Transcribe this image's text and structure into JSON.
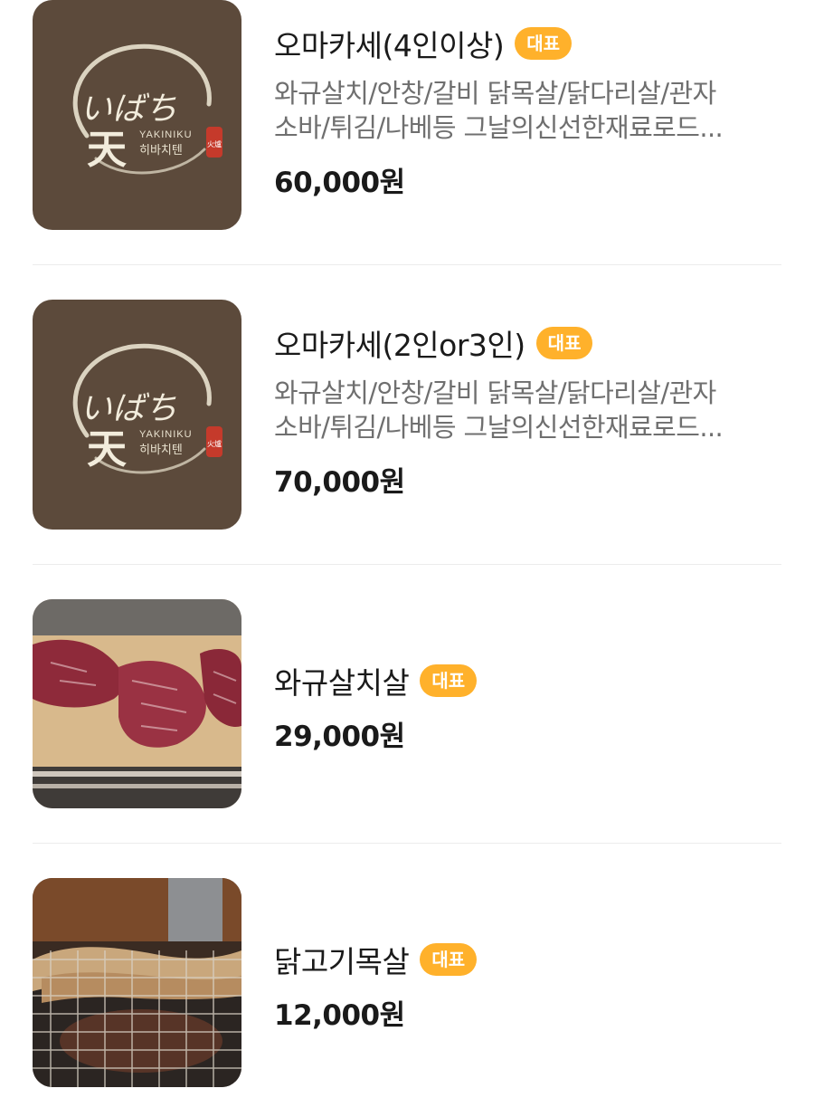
{
  "menu": {
    "items": [
      {
        "name": "오마카세(4인이상)",
        "badge": "대표",
        "desc_line1": "와규살치/안창/갈비 닭목살/닭다리살/관자",
        "desc_line2": "소바/튀김/나베등 그날의신선한재료로드...",
        "price": "60,000원",
        "logo": {
          "script": "いばち",
          "kanji": "天",
          "latin": "YAKINIKU",
          "korean": "히바치텐",
          "stamp": "火爐"
        }
      },
      {
        "name": "오마카세(2인or3인)",
        "badge": "대표",
        "desc_line1": "와규살치/안창/갈비 닭목살/닭다리살/관자",
        "desc_line2": "소바/튀김/나베등 그날의신선한재료로드...",
        "price": "70,000원",
        "logo": {
          "script": "いばち",
          "kanji": "天",
          "latin": "YAKINIKU",
          "korean": "히바치텐",
          "stamp": "火爐"
        }
      },
      {
        "name": "와규살치살",
        "badge": "대표",
        "price": "29,000원"
      },
      {
        "name": "닭고기목살",
        "badge": "대표",
        "price": "12,000원"
      }
    ]
  },
  "colors": {
    "badge": "#ffb12b",
    "logo_bg": "#5c4a3b",
    "description": "#6f6f6f",
    "divider": "#ececec"
  }
}
